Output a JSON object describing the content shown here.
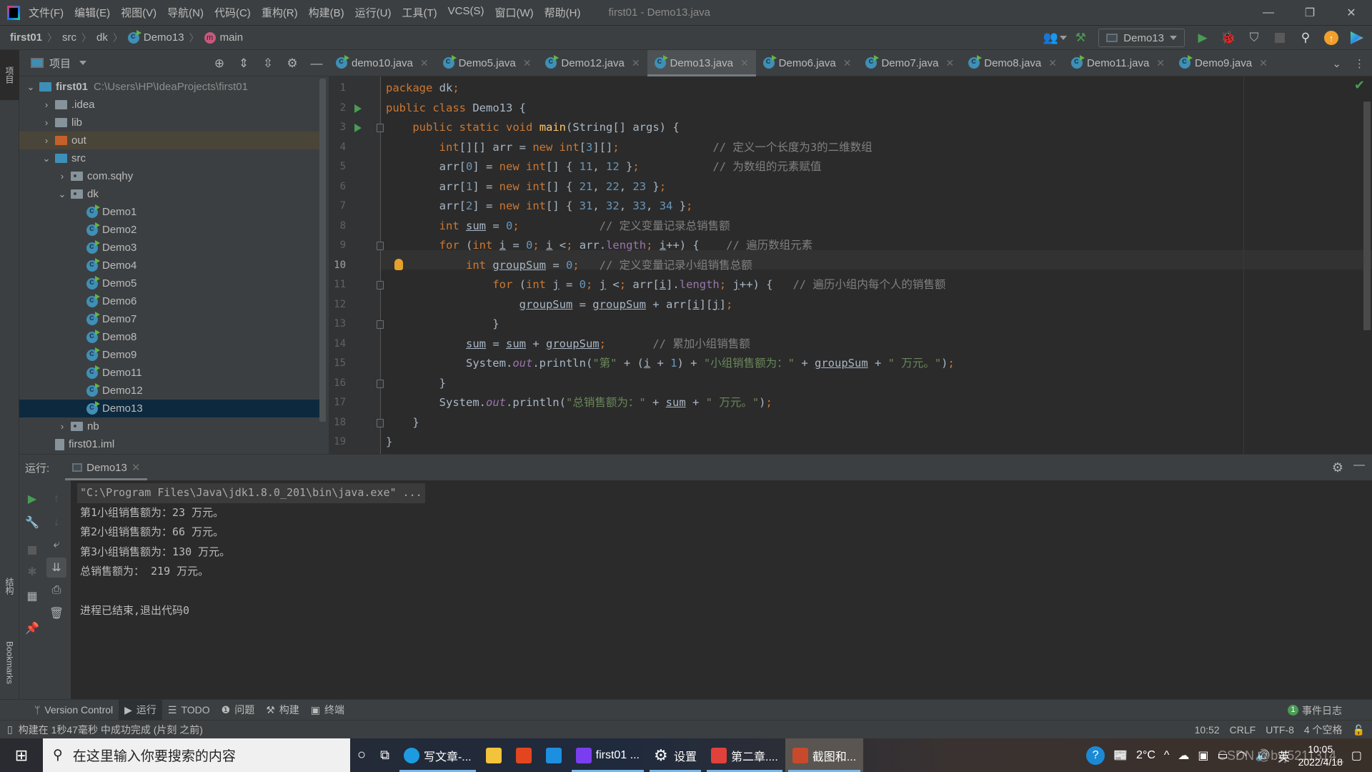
{
  "window": {
    "title": "first01 - Demo13.java",
    "menu": [
      "文件(F)",
      "编辑(E)",
      "视图(V)",
      "导航(N)",
      "代码(C)",
      "重构(R)",
      "构建(B)",
      "运行(U)",
      "工具(T)",
      "VCS(S)",
      "窗口(W)",
      "帮助(H)"
    ],
    "controls": {
      "minimize": "—",
      "restore": "❐",
      "close": "✕"
    }
  },
  "breadcrumb": [
    "first01",
    "src",
    "dk",
    "Demo13",
    "main"
  ],
  "toolbar": {
    "run_config": "Demo13",
    "icons": [
      "user-icon",
      "build-hammer-icon",
      "run-icon",
      "debug-icon",
      "coverage-icon",
      "stop-icon",
      "search-icon",
      "update-icon",
      "toolbox-icon"
    ]
  },
  "left_strip": {
    "project_label": "项目",
    "structure_label": "结构",
    "bookmarks_label": "Bookmarks"
  },
  "project": {
    "title": "项目",
    "tree": [
      {
        "label": "first01",
        "extra": "C:\\Users\\HP\\IdeaProjects\\first01",
        "type": "module",
        "level": 0,
        "expanded": true
      },
      {
        "label": ".idea",
        "type": "folder",
        "level": 1,
        "expanded": false
      },
      {
        "label": "lib",
        "type": "folder",
        "level": 1,
        "expanded": false
      },
      {
        "label": "out",
        "type": "folder-excluded",
        "level": 1,
        "expanded": false
      },
      {
        "label": "src",
        "type": "folder-source",
        "level": 1,
        "expanded": true
      },
      {
        "label": "com.sqhy",
        "type": "package",
        "level": 2,
        "expanded": false
      },
      {
        "label": "dk",
        "type": "package",
        "level": 2,
        "expanded": true
      },
      {
        "label": "Demo1",
        "type": "class",
        "level": 3
      },
      {
        "label": "Demo2",
        "type": "class",
        "level": 3
      },
      {
        "label": "Demo3",
        "type": "class",
        "level": 3
      },
      {
        "label": "Demo4",
        "type": "class",
        "level": 3
      },
      {
        "label": "Demo5",
        "type": "class",
        "level": 3
      },
      {
        "label": "Demo6",
        "type": "class",
        "level": 3
      },
      {
        "label": "Demo7",
        "type": "class",
        "level": 3
      },
      {
        "label": "Demo8",
        "type": "class",
        "level": 3
      },
      {
        "label": "Demo9",
        "type": "class",
        "level": 3
      },
      {
        "label": "Demo11",
        "type": "class",
        "level": 3
      },
      {
        "label": "Demo12",
        "type": "class",
        "level": 3
      },
      {
        "label": "Demo13",
        "type": "class",
        "level": 3,
        "selected": true
      },
      {
        "label": "nb",
        "type": "package",
        "level": 2,
        "expanded": false
      },
      {
        "label": "first01.iml",
        "type": "file",
        "level": 1
      }
    ]
  },
  "editor": {
    "tabs": [
      {
        "label": "demo10.java"
      },
      {
        "label": "Demo5.java"
      },
      {
        "label": "Demo12.java"
      },
      {
        "label": "Demo13.java",
        "active": true
      },
      {
        "label": "Demo6.java"
      },
      {
        "label": "Demo7.java"
      },
      {
        "label": "Demo8.java"
      },
      {
        "label": "Demo11.java"
      },
      {
        "label": "Demo9.java"
      }
    ],
    "current_line": 10,
    "lines": [
      "package dk;",
      "public class Demo13 {",
      "    public static void main(String[] args) {",
      "        int[][] arr = new int[3][];              // 定义一个长度为3的二维数组",
      "        arr[0] = new int[] { 11, 12 };           // 为数组的元素赋值",
      "        arr[1] = new int[] { 21, 22, 23 };",
      "        arr[2] = new int[] { 31, 32, 33, 34 };",
      "        int sum = 0;            // 定义变量记录总销售额",
      "        for (int i = 0; i < arr.length; i++) {    // 遍历数组元素",
      "            int groupSum = 0;   // 定义变量记录小组销售总额",
      "                for (int j = 0; j < arr[i].length; j++) {   // 遍历小组内每个人的销售额",
      "                    groupSum = groupSum + arr[i][j];",
      "                }",
      "            sum = sum + groupSum;       // 累加小组销售额",
      "            System.out.println(\"第\" + (i + 1) + \"小组销售额为：\" + groupSum + \" 万元。\");",
      "        }",
      "        System.out.println(\"总销售额为：\" + sum + \" 万元。\");",
      "    }",
      "}"
    ]
  },
  "run_panel": {
    "label": "运行:",
    "tab": "Demo13",
    "output": [
      "\"C:\\Program Files\\Java\\jdk1.8.0_201\\bin\\java.exe\" ...",
      "第1小组销售额为：23 万元。",
      "第2小组销售额为：66 万元。",
      "第3小组销售额为：130 万元。",
      "总销售额为： 219 万元。",
      "",
      "进程已结束,退出代码0"
    ]
  },
  "tool_windows": [
    "Version Control",
    "运行",
    "TODO",
    "问题",
    "构建",
    "终端"
  ],
  "event_log": {
    "count": "1",
    "label": "事件日志"
  },
  "status": {
    "message": "构建在 1秒47毫秒 中成功完成 (片刻 之前)",
    "position": "10:52",
    "line_sep": "CRLF",
    "encoding": "UTF-8",
    "indent": "4 个空格"
  },
  "taskbar": {
    "search_placeholder": "在这里输入你要搜索的内容",
    "apps": [
      {
        "label": "写文章-...",
        "icon": "edge-icon",
        "open": true
      },
      {
        "label": "",
        "icon": "file-explorer-icon"
      },
      {
        "label": "",
        "icon": "office-icon"
      },
      {
        "label": "",
        "icon": "mail-icon"
      },
      {
        "label": "first01 ...",
        "icon": "intellij-icon",
        "open": true
      },
      {
        "label": "设置",
        "icon": "settings-icon",
        "open": true
      },
      {
        "label": "第二章....",
        "icon": "wps-icon",
        "open": true
      },
      {
        "label": "截图和...",
        "icon": "snip-icon",
        "open": true,
        "active": true
      }
    ],
    "weather": "2°C",
    "ime": "英",
    "time": "10:05",
    "date": "2022/4/18",
    "watermark": "CSDN @byj5211314_"
  }
}
